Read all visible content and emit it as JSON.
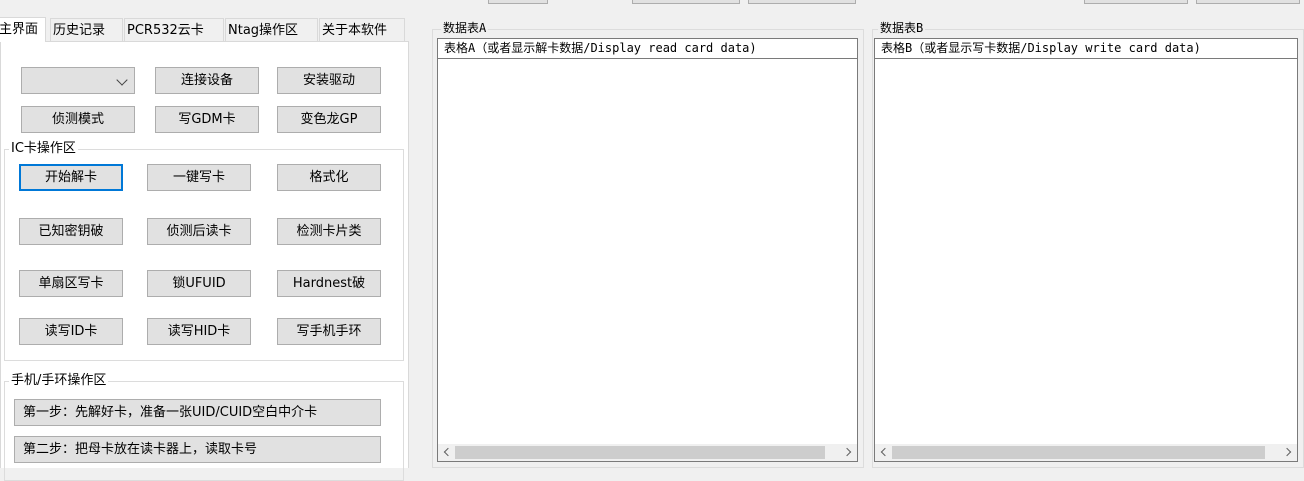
{
  "tabs": [
    {
      "label": "主界面"
    },
    {
      "label": "历史记录"
    },
    {
      "label": "PCR532云卡"
    },
    {
      "label": "Ntag操作区"
    },
    {
      "label": "关于本软件"
    }
  ],
  "device": {
    "selected": "",
    "connect_label": "连接设备",
    "driver_label": "安装驱动",
    "sniff_label": "侦测模式",
    "write_gdm_label": "写GDM卡",
    "chameleon_label": "变色龙GP"
  },
  "ic_group": {
    "title": "IC卡操作区",
    "buttons": [
      "开始解卡",
      "一键写卡",
      "格式化",
      "已知密钥破",
      "侦测后读卡",
      "检测卡片类",
      "单扇区写卡",
      "锁UFUID",
      "Hardnest破",
      "读写ID卡",
      "读写HID卡",
      "写手机手环"
    ]
  },
  "phone_group": {
    "title": "手机/手环操作区",
    "step1": "第一步：先解好卡，准备一张UID/CUID空白中介卡",
    "step2": "第二步：把母卡放在读卡器上，读取卡号"
  },
  "table_a": {
    "title": "数据表A",
    "header": "表格A（或者显示解卡数据/Display read card data)"
  },
  "table_b": {
    "title": "数据表B",
    "header": "表格B（或者显示写卡数据/Display write card data)"
  },
  "icons": {
    "dropdown": "chevron-down-icon",
    "scroll_left": "chevron-left-icon",
    "scroll_right": "chevron-right-icon"
  }
}
